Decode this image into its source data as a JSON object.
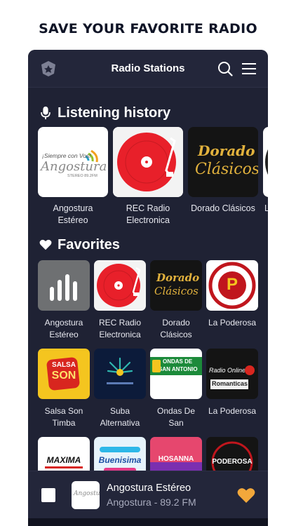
{
  "headline": "SAVE YOUR FAVORITE RADIO",
  "appbar": {
    "title": "Radio Stations",
    "icons": [
      "badge-icon",
      "search-icon",
      "menu-icon"
    ]
  },
  "history": {
    "title": "Listening history",
    "icon": "microphone-icon",
    "items": [
      {
        "name": "Angostura Estéreo",
        "art_line1": "¡Siempre con Vos!",
        "art_line2": "Angostura",
        "art_line3": "STEREO 89.2FM"
      },
      {
        "name": "REC Radio Electronica"
      },
      {
        "name": "Dorado Clásicos",
        "art_line1": "Dorado",
        "art_line2": "Clásicos"
      },
      {
        "name": "L"
      }
    ]
  },
  "favorites": {
    "title": "Favorites",
    "icon": "heart-icon",
    "items": [
      {
        "name": "Angostura Estéreo"
      },
      {
        "name": "REC Radio Electronica"
      },
      {
        "name": "Dorado Clásicos",
        "art_line1": "Dorado",
        "art_line2": "Clásicos"
      },
      {
        "name": "La Poderosa",
        "art_text": "P"
      },
      {
        "name": "Salsa Son Timba",
        "art_line1": "SALSA",
        "art_line2": "SON"
      },
      {
        "name": "Suba Alternativa"
      },
      {
        "name": "Ondas De San",
        "art_line1": "ONDAS DE",
        "art_line2": "SAN ANTONIO"
      },
      {
        "name": "La Poderosa",
        "art_line1": "Radio Online",
        "art_line2": "Romanticas"
      },
      {
        "name": "",
        "art_text": "MAXIMA"
      },
      {
        "name": "",
        "art_text": "Buenisima"
      },
      {
        "name": "",
        "art_text": "HOSANNA"
      },
      {
        "name": "",
        "art_text": "PODEROSA"
      }
    ]
  },
  "player": {
    "title": "Angostura Estéreo",
    "subtitle": "Angostura - 89.2 FM",
    "thumb_text": "Angostura",
    "heart_color": "#f2a83b"
  },
  "colors": {
    "background": "#1f2234",
    "bar": "#23263a",
    "accent": "#f2a83b",
    "record_red": "#e8202a"
  }
}
